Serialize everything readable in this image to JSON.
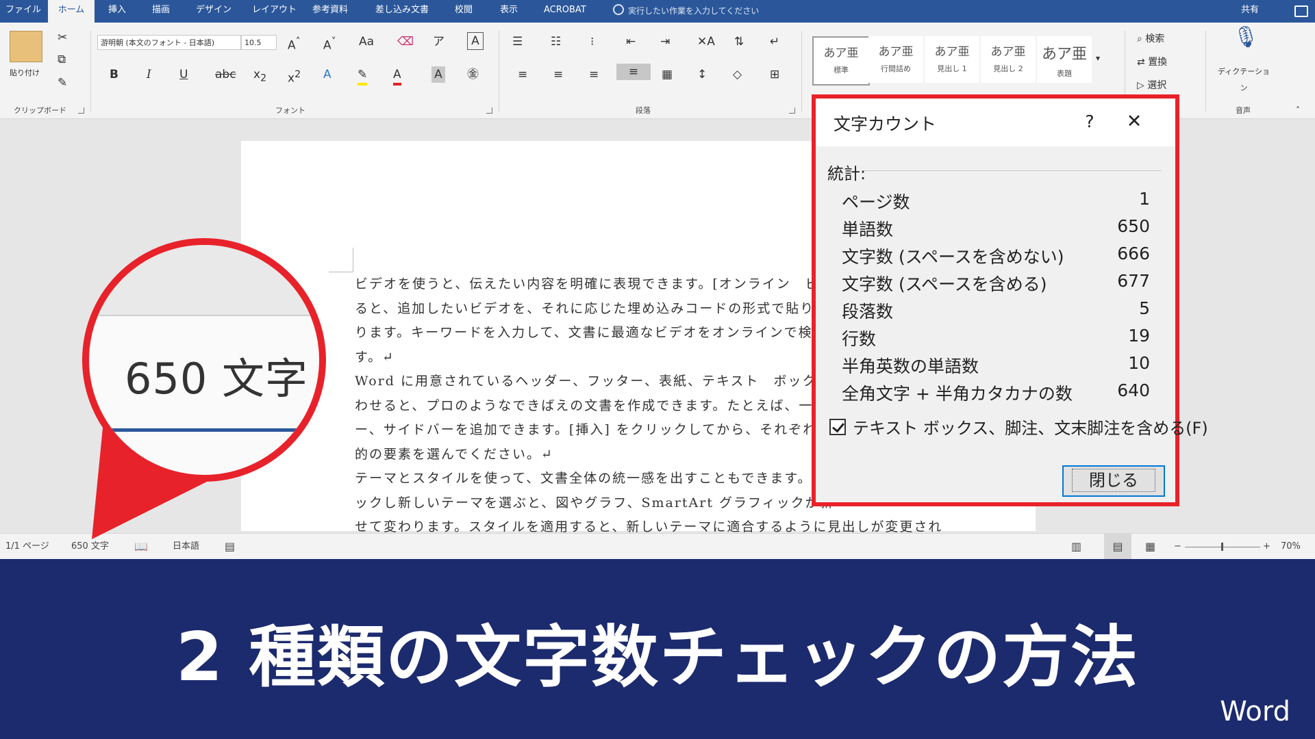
{
  "ribbon_tabs": [
    "ファイル",
    "ホーム",
    "挿入",
    "描画",
    "デザイン",
    "レイアウト",
    "参考資料",
    "差し込み文書",
    "校閲",
    "表示",
    "ACROBAT"
  ],
  "active_tab": "ホーム",
  "tell_me": "実行したい作業を入力してください",
  "share": "共有",
  "clipboard": {
    "paste": "貼り付け",
    "group": "クリップボード"
  },
  "font": {
    "name": "游明朝 (本文のフォント - 日本語)",
    "size": "10.5",
    "group": "フォント"
  },
  "paragraph": {
    "group": "段落"
  },
  "styles": [
    {
      "sample": "あア亜",
      "name": "標準"
    },
    {
      "sample": "あア亜",
      "name": "行間詰め"
    },
    {
      "sample": "あア亜",
      "name": "見出し 1"
    },
    {
      "sample": "あア亜",
      "name": "見出し 2"
    },
    {
      "sample": "あア亜",
      "name": "表題"
    }
  ],
  "editing": {
    "find": "検索",
    "replace": "置換",
    "select": "選択"
  },
  "voice": {
    "dictate": "ディクテーション",
    "group": "音声"
  },
  "document_lines": [
    "ビデオを使うと、伝えたい内容を明確に表現できます。[オンライン　ビデ",
    "ると、追加したいビデオを、それに応じた埋め込みコードの形式で貼り付",
    "ります。キーワードを入力して、文書に最適なビデオをオンラインで検索",
    "す。↵",
    "Word に用意されているヘッダー、フッター、表紙、テキスト　ボックス",
    "わせると、プロのようなできばえの文書を作成できます。たとえば、一致",
    "ー、サイドバーを追加できます。[挿入] をクリックしてから、それぞれ",
    "的の要素を選んでください。↵",
    "テーマとスタイルを使って、文書全体の統一感を出すこともできます。[",
    "ックし新しいテーマを選ぶと、図やグラフ、SmartArt グラフィックが新",
    "せて変わります。スタイルを適用すると、新しいテーマに適合するように見出しが変更され"
  ],
  "statusbar": {
    "page": "1/1 ページ",
    "words": "650 文字",
    "language": "日本語",
    "zoom": "70%"
  },
  "magnifier_text": "650 文字",
  "dialog": {
    "title": "文字カウント",
    "help": "?",
    "close_x": "✕",
    "stats_label": "統計:",
    "stats": [
      {
        "label": "ページ数",
        "value": "1"
      },
      {
        "label": "単語数",
        "value": "650"
      },
      {
        "label": "文字数 (スペースを含めない)",
        "value": "666"
      },
      {
        "label": "文字数 (スペースを含める)",
        "value": "677"
      },
      {
        "label": "段落数",
        "value": "5"
      },
      {
        "label": "行数",
        "value": "19"
      },
      {
        "label": "半角英数の単語数",
        "value": "10"
      },
      {
        "label": "全角文字 + 半角カタカナの数",
        "value": "640"
      }
    ],
    "include_label": "テキスト ボックス、脚注、文末脚注を含める(F)",
    "include_checked": true,
    "close_button": "閉じる"
  },
  "banner": {
    "title": "2 種類の文字数チェックの方法",
    "brand": "Word"
  },
  "colors": {
    "word_blue": "#2b579a",
    "highlight_red": "#e8222a",
    "banner_navy": "#1c2a6e"
  }
}
